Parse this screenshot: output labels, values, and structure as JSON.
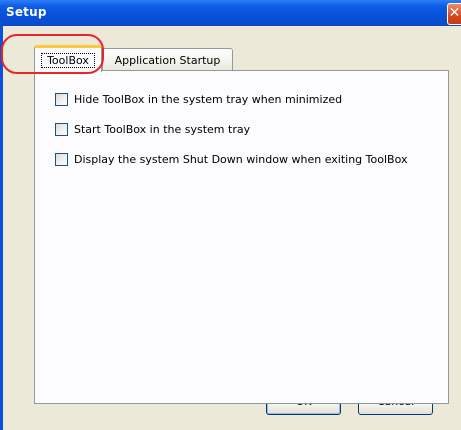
{
  "window": {
    "title": "Setup",
    "close_glyph": "✕"
  },
  "tabs": [
    {
      "label": "ToolBox",
      "selected": true
    },
    {
      "label": "Application Startup",
      "selected": false
    }
  ],
  "options": [
    {
      "label": "Hide ToolBox in the system tray when minimized",
      "checked": false
    },
    {
      "label": "Start ToolBox in the system tray",
      "checked": false
    },
    {
      "label": "Display the system Shut Down window when exiting ToolBox",
      "checked": false
    }
  ],
  "buttons": {
    "ok": "OK",
    "cancel": "Cancel"
  },
  "colors": {
    "titlebar": "#0a50d8",
    "client": "#ece9d8",
    "highlight": "#e8262a",
    "tab_accent": "#ffc83c"
  }
}
